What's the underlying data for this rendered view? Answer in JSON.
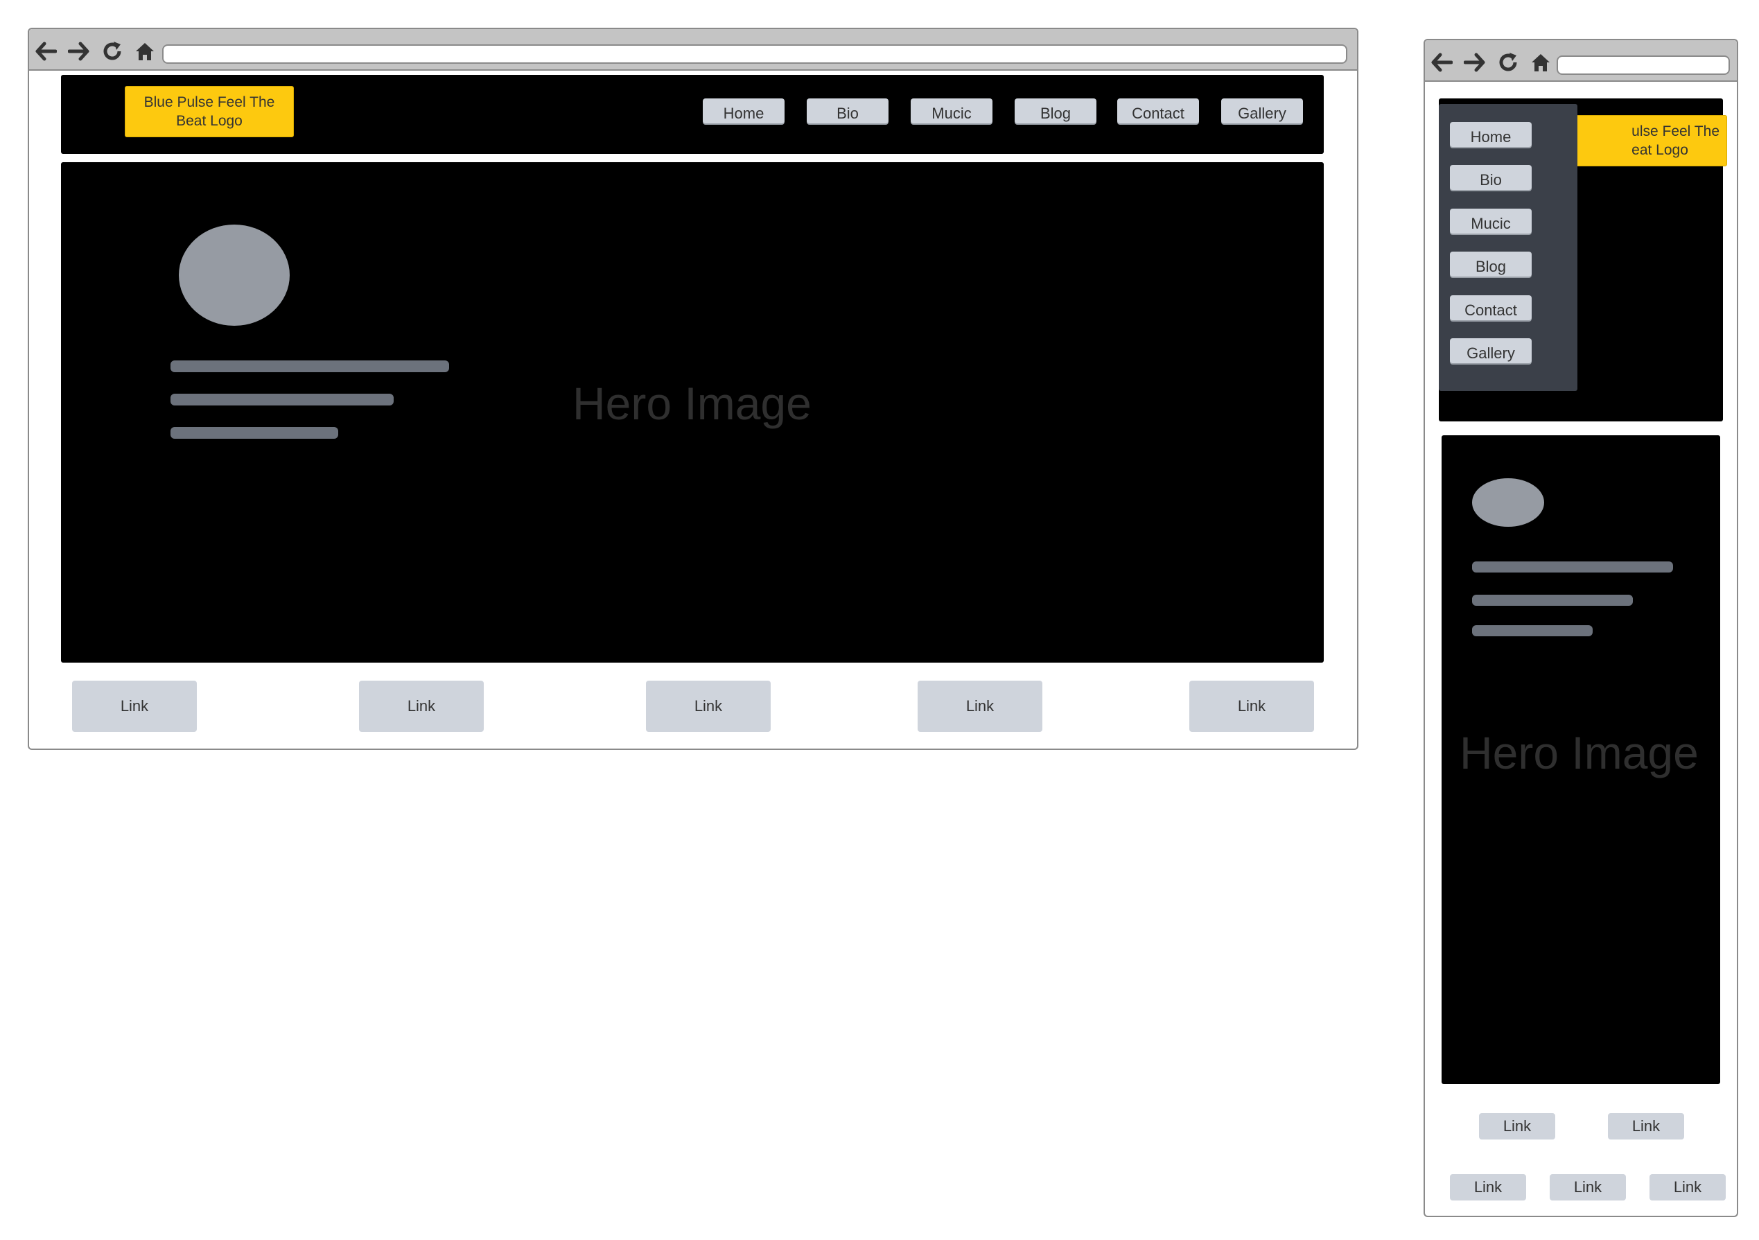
{
  "desktop": {
    "logo_text": "Blue Pulse Feel The Beat Logo",
    "nav": [
      "Home",
      "Bio",
      "Mucic",
      "Blog",
      "Contact",
      "Gallery"
    ],
    "hero_label": "Hero Image",
    "links": [
      "Link",
      "Link",
      "Link",
      "Link",
      "Link"
    ]
  },
  "mobile": {
    "logo_text": "ulse Feel The eat Logo",
    "logo_line1": "ulse Feel The",
    "logo_line2": "eat Logo",
    "menu": [
      "Home",
      "Bio",
      "Mucic",
      "Blog",
      "Contact",
      "Gallery"
    ],
    "hero_label": "Hero Image",
    "links": [
      "Link",
      "Link",
      "Link",
      "Link",
      "Link"
    ]
  },
  "icons": {
    "back": "arrow-left-icon",
    "forward": "arrow-right-icon",
    "reload": "reload-icon",
    "home": "home-icon"
  },
  "colors": {
    "logo_bg": "#fdc90f",
    "button_bg": "#cfd4dc",
    "hero_bg": "#000000",
    "menu_panel_bg": "#3b4049",
    "chrome_bg": "#c4c4c4"
  }
}
